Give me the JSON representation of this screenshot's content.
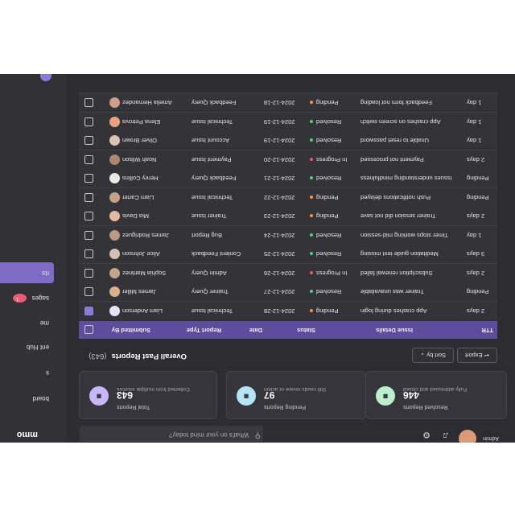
{
  "sidebar": {
    "brand": "mmo",
    "items": [
      {
        "label": "board"
      },
      {
        "label": "s"
      },
      {
        "label": "ent Hub"
      },
      {
        "label": "me"
      },
      {
        "label": "sages",
        "badge": "1"
      },
      {
        "label": "rts",
        "active": true
      }
    ]
  },
  "topbar": {
    "search_placeholder": "What's on your mind today?",
    "user_name": "Admin"
  },
  "stats": [
    {
      "label": "Total Reports",
      "value": "643",
      "sub": "Collected from multiple sources",
      "icon": "document-icon",
      "icon_color": "#c7b7f6"
    },
    {
      "label": "Pending Reports",
      "value": "97",
      "sub": "Still needs review or action",
      "icon": "filter-icon",
      "icon_color": "#b5e4f5"
    },
    {
      "label": "Resolved Reports",
      "value": "446",
      "sub": "Fully addressed and closed",
      "icon": "trend-icon",
      "icon_color": "#bdeecb"
    }
  ],
  "section": {
    "title": "Overall Past Reports",
    "count": "(643)",
    "sort_label": "Sort by",
    "export_label": "Export"
  },
  "table": {
    "headers": [
      "Submitted By",
      "Report Type",
      "Date",
      "Status",
      "Issue Details",
      "TTR"
    ],
    "rows": [
      {
        "name": "Liam Anderson",
        "type": "Technical Issue",
        "date": "2024-12-28",
        "status": "Pending",
        "details": "App crashes during login",
        "ttr": "2 days",
        "checked": true,
        "avatar": "#e9e2f7"
      },
      {
        "name": "James Miller",
        "type": "Trainer Query",
        "date": "2024-12-27",
        "status": "Resolved",
        "details": "Trainer was unavailable",
        "ttr": "Pending",
        "checked": false,
        "avatar": "#d9b08c"
      },
      {
        "name": "Sophia Martinez",
        "type": "Admin Query",
        "date": "2024-12-26",
        "status": "In Progress",
        "details": "Subscription renewal failed",
        "ttr": "2 days",
        "checked": false,
        "avatar": "#c2a38b"
      },
      {
        "name": "Alice Johnson",
        "type": "Content Feedback",
        "date": "2024-12-25",
        "status": "Resolved",
        "details": "Meditation guide text missing",
        "ttr": "3 days",
        "checked": false,
        "avatar": "#d2c3b5"
      },
      {
        "name": "James Rodriguez",
        "type": "Bug Report",
        "date": "2024-12-24",
        "status": "Resolved",
        "details": "Timer stops working mid-session",
        "ttr": "1 day",
        "checked": false,
        "avatar": "#b99a83"
      },
      {
        "name": "Mia Davis",
        "type": "Trainer Issue",
        "date": "2024-12-23",
        "status": "Pending",
        "details": "Trainer session did not save",
        "ttr": "2 days",
        "checked": false,
        "avatar": "#e0b9a0"
      },
      {
        "name": "Liam Carter",
        "type": "Technical Issue",
        "date": "2024-12-22",
        "status": "Pending",
        "details": "Push notifications delayed",
        "ttr": "Pending",
        "checked": false,
        "avatar": "#c7a08a"
      },
      {
        "name": "Henry Collins",
        "type": "Feedback Query",
        "date": "2024-12-21",
        "status": "Resolved",
        "details": "Issues understanding mindfulness",
        "ttr": "Pending",
        "checked": false,
        "avatar": "#ece7e2"
      },
      {
        "name": "Noah Wilson",
        "type": "Payment Issue",
        "date": "2024-12-20",
        "status": "In Progress",
        "details": "Payment not processed",
        "ttr": "2 days",
        "checked": false,
        "avatar": "#a98872"
      },
      {
        "name": "Oliver Brown",
        "type": "Account Issue",
        "date": "2024-12-19",
        "status": "Resolved",
        "details": "Unable to reset password",
        "ttr": "1 day",
        "checked": false,
        "avatar": "#d8c5b6"
      },
      {
        "name": "Elena Petrova",
        "type": "Technical Issue",
        "date": "2024-12-19",
        "status": "Resolved",
        "details": "App crashes on screen switch",
        "ttr": "1 day",
        "checked": false,
        "avatar": "#e7a37f"
      },
      {
        "name": "Amelia Hernandez",
        "type": "Feedback Query",
        "date": "2024-12-18",
        "status": "Pending",
        "details": "Feedback form not loading",
        "ttr": "1 day",
        "checked": false,
        "avatar": "#caa08a"
      }
    ]
  },
  "status_colors": {
    "Pending": "#f0944a",
    "Resolved": "#4fcf7e",
    "In Progress": "#e8566c"
  }
}
